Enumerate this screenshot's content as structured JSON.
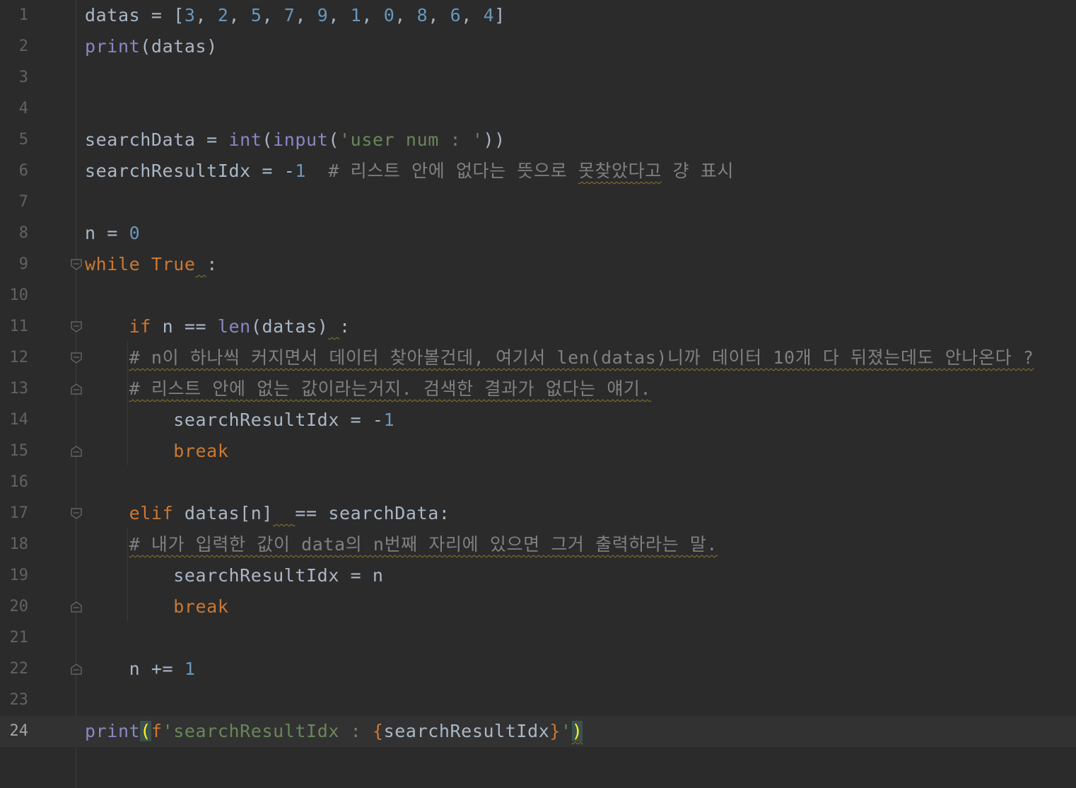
{
  "editor": {
    "lines": [
      {
        "n": "1",
        "tokens": [
          [
            "txt",
            "datas = ["
          ],
          [
            "num",
            "3"
          ],
          [
            "txt",
            ", "
          ],
          [
            "num",
            "2"
          ],
          [
            "txt",
            ", "
          ],
          [
            "num",
            "5"
          ],
          [
            "txt",
            ", "
          ],
          [
            "num",
            "7"
          ],
          [
            "txt",
            ", "
          ],
          [
            "num",
            "9"
          ],
          [
            "txt",
            ", "
          ],
          [
            "num",
            "1"
          ],
          [
            "txt",
            ", "
          ],
          [
            "num",
            "0"
          ],
          [
            "txt",
            ", "
          ],
          [
            "num",
            "8"
          ],
          [
            "txt",
            ", "
          ],
          [
            "num",
            "6"
          ],
          [
            "txt",
            ", "
          ],
          [
            "num",
            "4"
          ],
          [
            "txt",
            "]"
          ]
        ]
      },
      {
        "n": "2",
        "tokens": [
          [
            "bi",
            "print"
          ],
          [
            "txt",
            "(datas)"
          ]
        ]
      },
      {
        "n": "3",
        "tokens": []
      },
      {
        "n": "4",
        "tokens": []
      },
      {
        "n": "5",
        "tokens": [
          [
            "txt",
            "searchData = "
          ],
          [
            "bi",
            "int"
          ],
          [
            "txt",
            "("
          ],
          [
            "bi",
            "input"
          ],
          [
            "txt",
            "("
          ],
          [
            "str",
            "'user num : '"
          ],
          [
            "txt",
            "))"
          ]
        ]
      },
      {
        "n": "6",
        "tokens": [
          [
            "txt",
            "searchResultIdx = -"
          ],
          [
            "num",
            "1"
          ],
          [
            "txt",
            "  "
          ],
          [
            "cm",
            "# 리스트 안에 없다는 뜻으로 "
          ],
          [
            "cmsq",
            "못찾았다고"
          ],
          [
            "cm",
            " 걍 표시"
          ]
        ]
      },
      {
        "n": "7",
        "tokens": []
      },
      {
        "n": "8",
        "tokens": [
          [
            "txt",
            "n = "
          ],
          [
            "num",
            "0"
          ]
        ]
      },
      {
        "n": "9",
        "tokens": [
          [
            "kw",
            "while"
          ],
          [
            "txt",
            " "
          ],
          [
            "kw",
            "True"
          ],
          [
            "sq",
            " "
          ],
          [
            "txt",
            ":"
          ]
        ]
      },
      {
        "n": "10",
        "tokens": []
      },
      {
        "n": "11",
        "tokens": [
          [
            "txt",
            "    "
          ],
          [
            "kw",
            "if"
          ],
          [
            "txt",
            " n == "
          ],
          [
            "bi",
            "len"
          ],
          [
            "txt",
            "(datas)"
          ],
          [
            "sq",
            " "
          ],
          [
            "txt",
            ":"
          ]
        ]
      },
      {
        "n": "12",
        "tokens": [
          [
            "txt",
            "    "
          ],
          [
            "cmsq",
            "# n이 하나씩 커지면서 데이터 찾아볼건데, 여기서 len(datas)니까 데이터 10개 다 뒤졌는데도 안나온다 ?"
          ]
        ]
      },
      {
        "n": "13",
        "tokens": [
          [
            "txt",
            "    "
          ],
          [
            "cmsq",
            "# 리스트 안에 없는 값이라는거지. 검색한 결과가 없다는 얘기."
          ]
        ]
      },
      {
        "n": "14",
        "tokens": [
          [
            "txt",
            "        searchResultIdx = -"
          ],
          [
            "num",
            "1"
          ]
        ]
      },
      {
        "n": "15",
        "tokens": [
          [
            "txt",
            "        "
          ],
          [
            "kw",
            "break"
          ]
        ]
      },
      {
        "n": "16",
        "tokens": []
      },
      {
        "n": "17",
        "tokens": [
          [
            "txt",
            "    "
          ],
          [
            "kw",
            "elif"
          ],
          [
            "txt",
            " datas[n]"
          ],
          [
            "sq",
            "  "
          ],
          [
            "txt",
            "== searchData:"
          ]
        ]
      },
      {
        "n": "18",
        "tokens": [
          [
            "txt",
            "    "
          ],
          [
            "cmsq",
            "# 내가 입력한 값이 data의 n번째 자리에 있으면 그거 출력하라는 말."
          ]
        ]
      },
      {
        "n": "19",
        "tokens": [
          [
            "txt",
            "        searchResultIdx = n"
          ]
        ]
      },
      {
        "n": "20",
        "tokens": [
          [
            "txt",
            "        "
          ],
          [
            "kw",
            "break"
          ]
        ]
      },
      {
        "n": "21",
        "tokens": []
      },
      {
        "n": "22",
        "tokens": [
          [
            "txt",
            "    n += "
          ],
          [
            "num",
            "1"
          ]
        ]
      },
      {
        "n": "23",
        "tokens": []
      },
      {
        "n": "24",
        "tokens": [
          [
            "bi",
            "print"
          ],
          [
            "parenhl",
            "("
          ],
          [
            "kw",
            "f"
          ],
          [
            "str",
            "'searchResultIdx : "
          ],
          [
            "bracehl",
            "{"
          ],
          [
            "txt",
            "searchResultIdx"
          ],
          [
            "bracehl",
            "}"
          ],
          [
            "str",
            "'"
          ],
          [
            "parenhlsq",
            ")"
          ]
        ]
      }
    ],
    "current_line": "24",
    "fold_markers": [
      {
        "line": "9",
        "kind": "open"
      },
      {
        "line": "11",
        "kind": "open"
      },
      {
        "line": "12",
        "kind": "open"
      },
      {
        "line": "13",
        "kind": "close"
      },
      {
        "line": "15",
        "kind": "close"
      },
      {
        "line": "17",
        "kind": "open"
      },
      {
        "line": "20",
        "kind": "close"
      },
      {
        "line": "22",
        "kind": "close"
      }
    ],
    "colors": {
      "background": "#2b2b2b",
      "text": "#a9b7c6",
      "keyword": "#cc7832",
      "builtin": "#8888c6",
      "number": "#6897bb",
      "string": "#6a8759",
      "comment": "#808080",
      "line_number": "#606366",
      "current_line_bg": "#323232"
    }
  }
}
